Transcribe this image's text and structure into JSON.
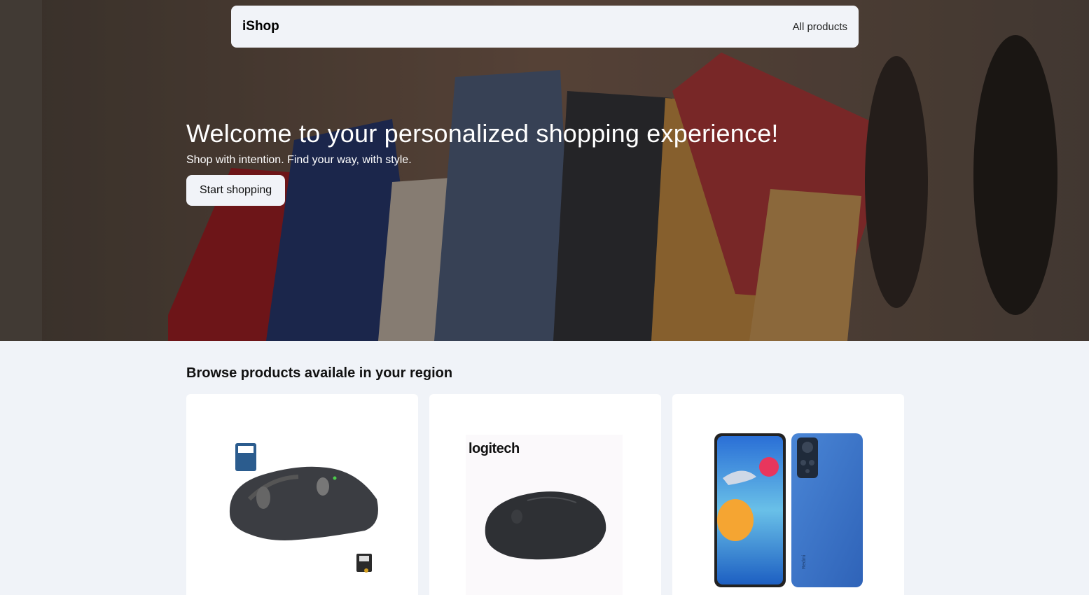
{
  "navbar": {
    "brand": "iShop",
    "all_products": "All products"
  },
  "hero": {
    "title": "Welcome to your personalized shopping experience!",
    "subtitle": "Shop with intention. Find your way, with style.",
    "cta_label": "Start shopping"
  },
  "products": {
    "heading": "Browse products availale in your region",
    "items": [
      {
        "image": "wireless-mouse-mx-image"
      },
      {
        "image": "logitech-mouse-image",
        "brand_text": "logitech"
      },
      {
        "image": "redmi-phone-image",
        "brand_text": "Redmi"
      }
    ]
  },
  "colors": {
    "page_bg": "#f0f3f8",
    "nav_bg": "#f1f3f8",
    "card_bg": "#ffffff"
  }
}
